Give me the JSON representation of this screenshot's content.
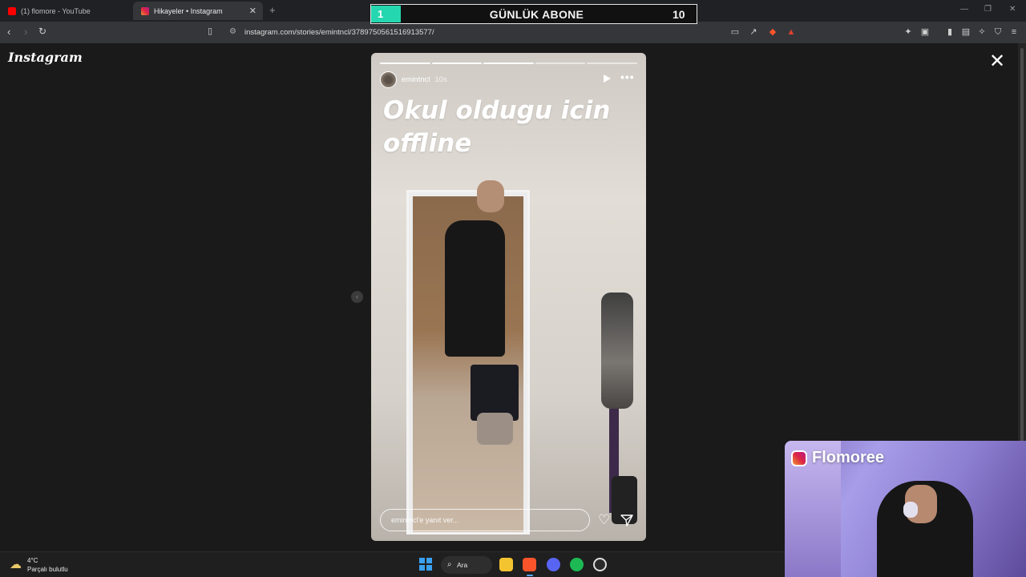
{
  "browser": {
    "tabs": [
      {
        "label": "(1) flomore - YouTube",
        "favicon_color": "#ff0000",
        "active": false
      },
      {
        "label": "Hikayeler • Instagram",
        "favicon_color": "#c13584",
        "active": true
      }
    ],
    "new_tab_icon": "+",
    "window_controls": [
      "—",
      "❐",
      "✕"
    ],
    "url": "instagram.com/stories/emintncl/3789750561516913577/",
    "nav_icons": [
      "back-icon",
      "forward-icon",
      "reload-icon",
      "bookmark-icon"
    ]
  },
  "overlay": {
    "current": "1",
    "title": "GÜNLÜK ABONE",
    "goal": "10",
    "accent": "#25d7b0"
  },
  "instagram": {
    "logo": "Instagram",
    "close_icon": "✕",
    "prev_icon": "‹",
    "story": {
      "username": "emintncl",
      "time": "10s",
      "caption": "Okul oldugu icin offline",
      "progress_segments": 5,
      "current_segment": 3,
      "reply_placeholder": "emintncl'e yanıt ver...",
      "heart_icon": "♡",
      "more_icon": "•••"
    }
  },
  "webcam": {
    "name": "Flomoree"
  },
  "taskbar": {
    "weather_temp": "4°C",
    "weather_desc": "Parçalı bulutlu",
    "search_label": "Ara",
    "apps": [
      "file-explorer-icon",
      "brave-icon",
      "discord-icon",
      "spotify-icon",
      "obs-icon"
    ]
  }
}
